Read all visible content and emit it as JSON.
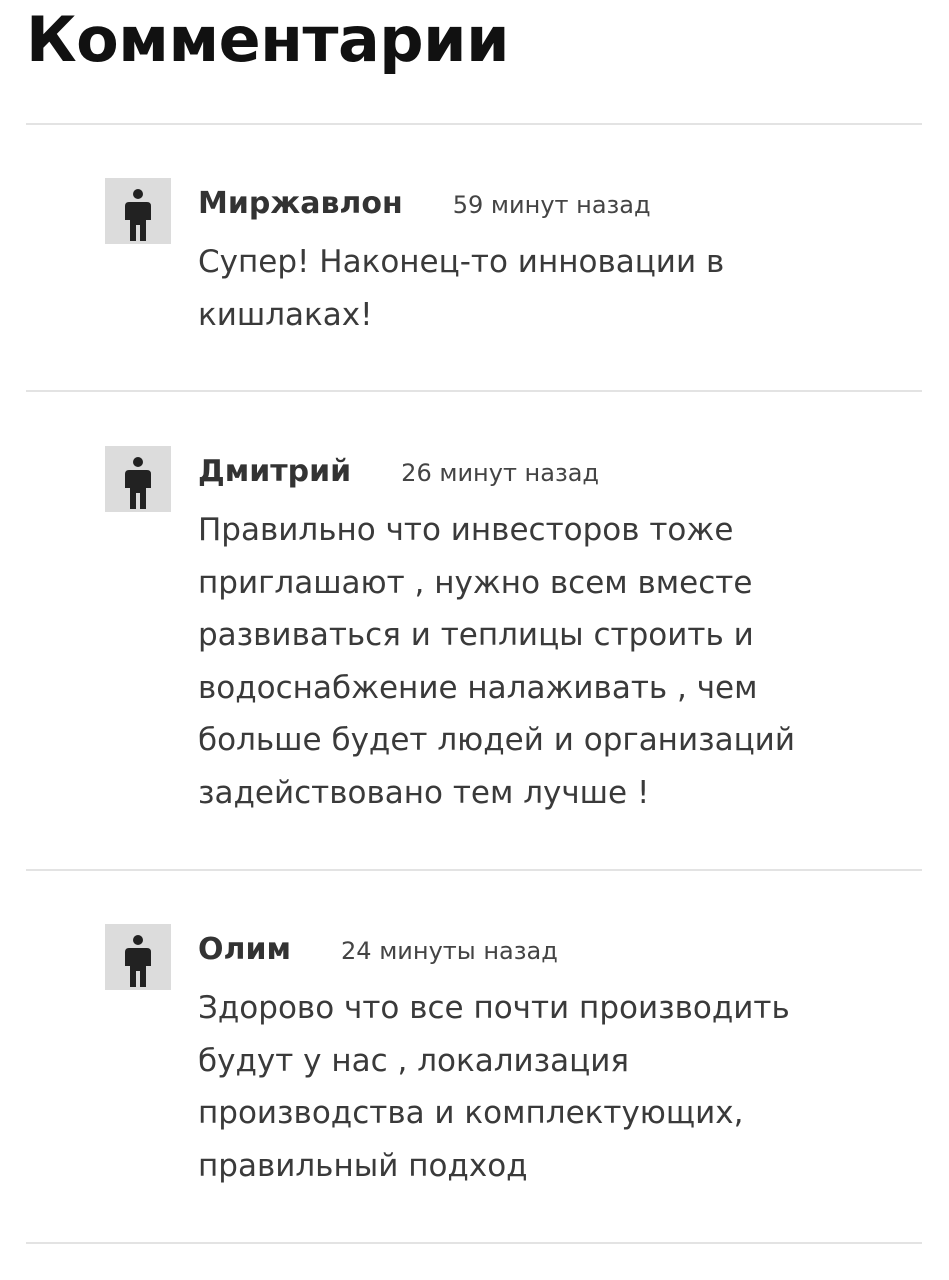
{
  "page": {
    "title": "Комментарии"
  },
  "comments": [
    {
      "author": "Миржавлон",
      "time": "59 минут назад",
      "text": "Супер! Наконец-то инновации в\nкишлаках!",
      "avatar_icon": "person-icon"
    },
    {
      "author": "Дмитрий",
      "time": "26 минут назад",
      "text": "Правильно что инвесторов тоже\nприглашают , нужно всем вместе\nразвиваться и теплицы строить и\nводоснабжение налаживать , чем\nбольше будет людей и организаций\nзадействовано тем лучше !",
      "avatar_icon": "person-icon"
    },
    {
      "author": "Олим",
      "time": "24 минуты назад",
      "text": "Здорово что все почти производить\nбудут у нас , локализация\nпроизводства и комплектующих,\nправильный подход",
      "avatar_icon": "person-icon"
    }
  ],
  "colors": {
    "background": "#ffffff",
    "title": "#111111",
    "text": "#3a3a3a",
    "divider": "#e3e3e3",
    "avatar_bg": "#dcdcdc",
    "avatar_icon": "#222222"
  }
}
